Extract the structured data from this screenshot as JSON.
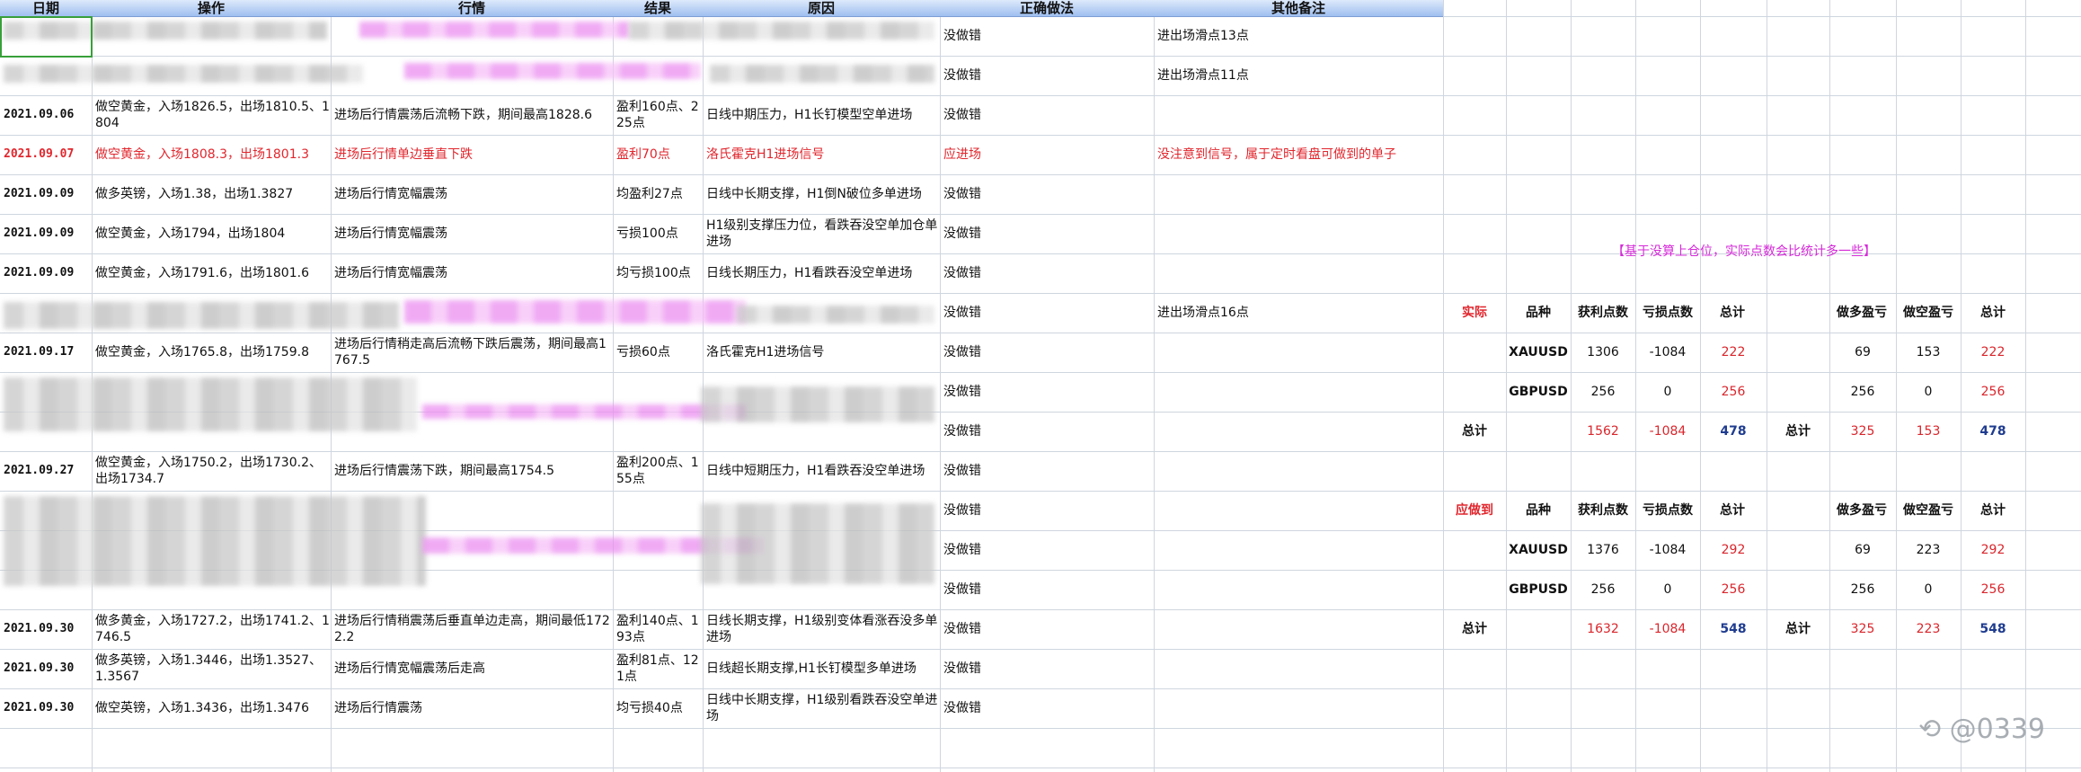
{
  "headers": [
    "日期",
    "操作",
    "行情",
    "结果",
    "原因",
    "正确做法",
    "其他备注"
  ],
  "rows": [
    {
      "date": "",
      "op": "",
      "market": "",
      "result": "",
      "reason": "",
      "correct": "没做错",
      "note": "进出场滑点13点",
      "red": false
    },
    {
      "date": "",
      "op": "",
      "market": "",
      "result": "",
      "reason": "",
      "correct": "没做错",
      "note": "进出场滑点11点",
      "red": false
    },
    {
      "date": "2021.09.06",
      "op": "做空黄金，入场1826.5，出场1810.5、1804",
      "market": "进场后行情震荡后流畅下跌，期间最高1828.6",
      "result": "盈利160点、225点",
      "reason": "日线中期压力，H1长钉模型空单进场",
      "correct": "没做错",
      "note": "",
      "red": false
    },
    {
      "date": "2021.09.07",
      "op": "做空黄金，入场1808.3，出场1801.3",
      "market": "进场后行情单边垂直下跌",
      "result": "盈利70点",
      "reason": "洛氏霍克H1进场信号",
      "correct": "应进场",
      "note": "没注意到信号，属于定时看盘可做到的单子",
      "red": true
    },
    {
      "date": "2021.09.09",
      "op": "做多英镑，入场1.38，出场1.3827",
      "market": "进场后行情宽幅震荡",
      "result": "均盈利27点",
      "reason": "日线中长期支撑，H1倒N破位多单进场",
      "correct": "没做错",
      "note": "",
      "red": false
    },
    {
      "date": "2021.09.09",
      "op": "做空黄金，入场1794，出场1804",
      "market": "进场后行情宽幅震荡",
      "result": "亏损100点",
      "reason": "H1级别支撑压力位，看跌吞没空单加仓单进场",
      "correct": "没做错",
      "note": "",
      "red": false
    },
    {
      "date": "2021.09.09",
      "op": "做空黄金，入场1791.6，出场1801.6",
      "market": "进场后行情宽幅震荡",
      "result": "均亏损100点",
      "reason": "日线长期压力，H1看跌吞没空单进场",
      "correct": "没做错",
      "note": "",
      "red": false
    },
    {
      "date": "",
      "op": "",
      "market": "",
      "result": "",
      "reason": "",
      "correct": "没做错",
      "note": "进出场滑点16点",
      "red": false
    },
    {
      "date": "2021.09.17",
      "op": "做空黄金，入场1765.8，出场1759.8",
      "market": "进场后行情稍走高后流畅下跌后震荡，期间最高1767.5",
      "result": "亏损60点",
      "reason": "洛氏霍克H1进场信号",
      "correct": "没做错",
      "note": "",
      "red": false
    },
    {
      "date": "",
      "op": "",
      "market": "",
      "result": "",
      "reason": "",
      "correct": "没做错",
      "note": "",
      "red": false
    },
    {
      "date": "",
      "op": "",
      "market": "",
      "result": "",
      "reason": "",
      "correct": "没做错",
      "note": "",
      "red": false
    },
    {
      "date": "2021.09.27",
      "op": "做空黄金，入场1750.2，出场1730.2、出场1734.7",
      "market": "进场后行情震荡下跌，期间最高1754.5",
      "result": "盈利200点、155点",
      "reason": "日线中短期压力，H1看跌吞没空单进场",
      "correct": "没做错",
      "note": "",
      "red": false
    },
    {
      "date": "",
      "op": "",
      "market": "",
      "result": "",
      "reason": "",
      "correct": "没做错",
      "note": "",
      "red": false
    },
    {
      "date": "",
      "op": "",
      "market": "",
      "result": "",
      "reason": "",
      "correct": "没做错",
      "note": "",
      "red": false
    },
    {
      "date": "",
      "op": "",
      "market": "",
      "result": "",
      "reason": "",
      "correct": "没做错",
      "note": "",
      "red": false
    },
    {
      "date": "2021.09.30",
      "op": "做多黄金，入场1727.2，出场1741.2、1746.5",
      "market": "进场后行情稍震荡后垂直单边走高，期间最低1722.2",
      "result": "盈利140点、193点",
      "reason": "日线长期支撑，H1级别变体看涨吞没多单进场",
      "correct": "没做错",
      "note": "",
      "red": false
    },
    {
      "date": "2021.09.30",
      "op": "做多英镑，入场1.3446，出场1.3527、1.3567",
      "market": "进场后行情宽幅震荡后走高",
      "result": "盈利81点、121点",
      "reason": "日线超长期支撑,H1长钉模型多单进场",
      "correct": "没做错",
      "note": "",
      "red": false
    },
    {
      "date": "2021.09.30",
      "op": "做空英镑，入场1.3436，出场1.3476",
      "market": "进场后行情震荡",
      "result": "均亏损40点",
      "reason": "日线中长期支撑，H1级别看跌吞没空单进场",
      "correct": "没做错",
      "note": "",
      "red": false
    }
  ],
  "side_note": "【基于没算上仓位，实际点数会比统计多一些】",
  "summary": {
    "actual": {
      "label": "实际",
      "headers": [
        "品种",
        "获利点数",
        "亏损点数",
        "总计",
        "",
        "做多盈亏",
        "做空盈亏",
        "总计"
      ],
      "rows": [
        {
          "symbol": "XAUUSD",
          "profit": "1306",
          "loss": "-1084",
          "total": "222",
          "long": "69",
          "short": "153",
          "total2": "222"
        },
        {
          "symbol": "GBPUSD",
          "profit": "256",
          "loss": "0",
          "total": "256",
          "long": "256",
          "short": "0",
          "total2": "256"
        }
      ],
      "sum": {
        "label": "总计",
        "profit": "1562",
        "loss": "-1084",
        "total": "478",
        "label2": "总计",
        "long": "325",
        "short": "153",
        "total2": "478"
      }
    },
    "should": {
      "label": "应做到",
      "headers": [
        "品种",
        "获利点数",
        "亏损点数",
        "总计",
        "",
        "做多盈亏",
        "做空盈亏",
        "总计"
      ],
      "rows": [
        {
          "symbol": "XAUUSD",
          "profit": "1376",
          "loss": "-1084",
          "total": "292",
          "long": "69",
          "short": "223",
          "total2": "292"
        },
        {
          "symbol": "GBPUSD",
          "profit": "256",
          "loss": "0",
          "total": "256",
          "long": "256",
          "short": "0",
          "total2": "256"
        }
      ],
      "sum": {
        "label": "总计",
        "profit": "1632",
        "loss": "-1084",
        "total": "548",
        "label2": "总计",
        "long": "325",
        "short": "223",
        "total2": "548"
      }
    }
  },
  "watermark": "@0339"
}
